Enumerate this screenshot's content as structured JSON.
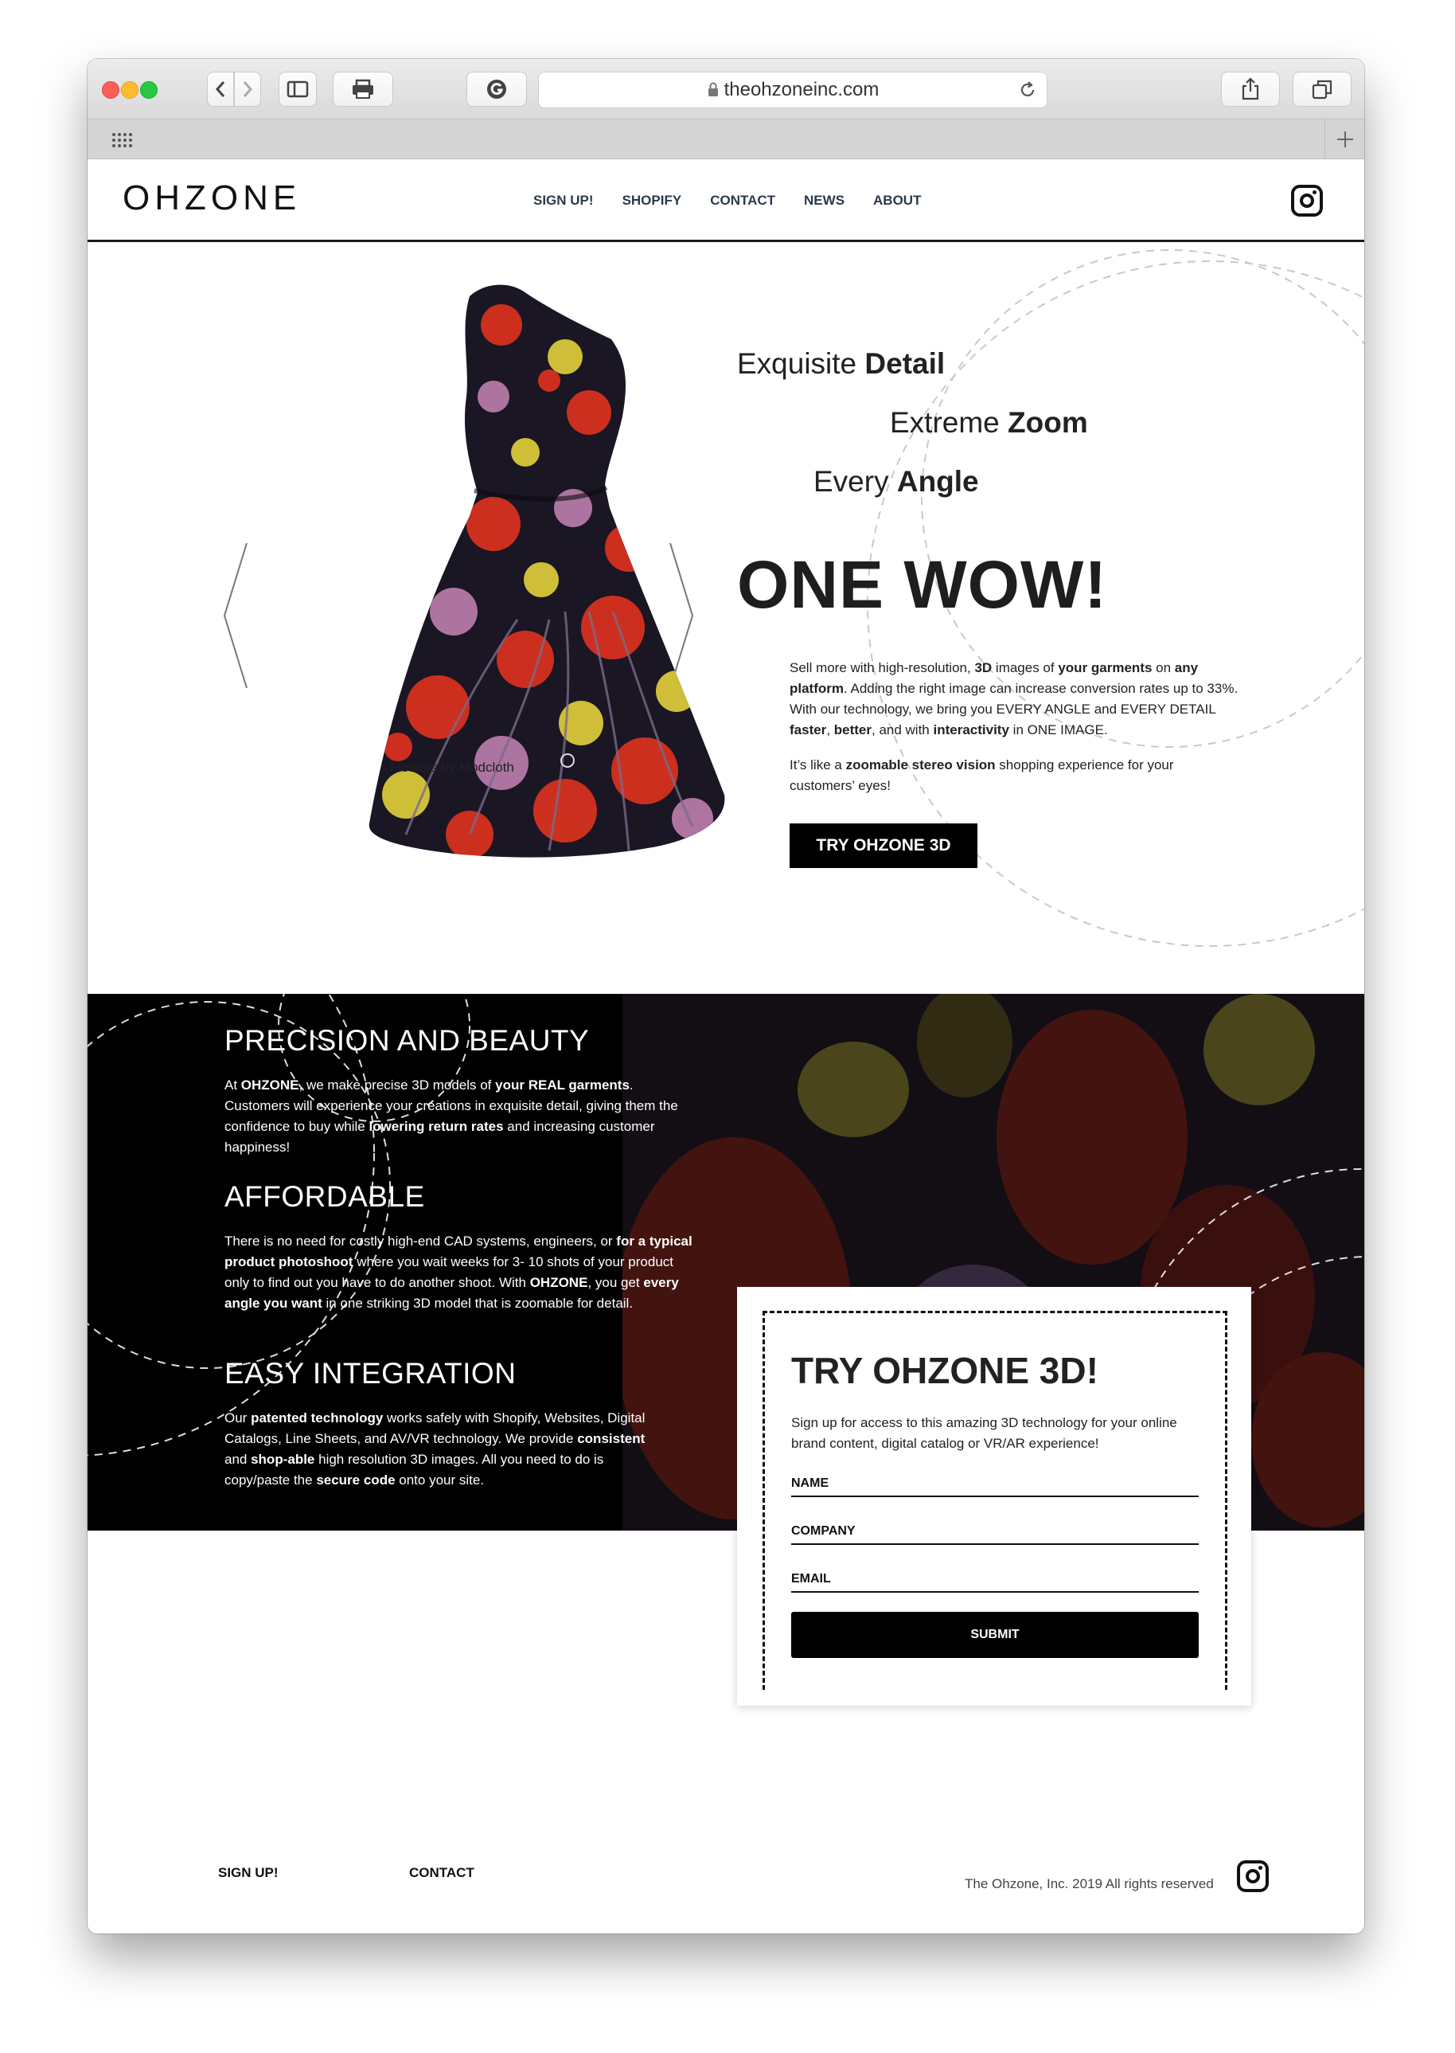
{
  "browser": {
    "url": "theohzoneinc.com"
  },
  "nav": {
    "logo": "OHZONE",
    "items": [
      "SIGN UP!",
      "SHOPIFY",
      "CONTACT",
      "NEWS",
      "ABOUT"
    ]
  },
  "hero": {
    "tagline1": {
      "light": "Exquisite ",
      "bold": "Detail"
    },
    "tagline2": {
      "light": "Extreme ",
      "bold": "Zoom"
    },
    "tagline3": {
      "light": "Every ",
      "bold": "Angle"
    },
    "headline": "ONE WOW!",
    "paragraph1": [
      {
        "t": "Sell more with high-resolution, "
      },
      {
        "t": "3D",
        "b": true
      },
      {
        "t": " images of "
      },
      {
        "t": "your garments",
        "b": true
      },
      {
        "t": " on "
      },
      {
        "t": "any platform",
        "b": true
      },
      {
        "t": ". Adding the right image can increase conversion rates up to 33%. With our technology, we bring you EVERY ANGLE and EVERY DETAIL "
      },
      {
        "t": "faster",
        "b": true
      },
      {
        "t": ", "
      },
      {
        "t": "better",
        "b": true
      },
      {
        "t": ", and with "
      },
      {
        "t": "interactivity",
        "b": true
      },
      {
        "t": " in ONE IMAGE."
      }
    ],
    "paragraph2": [
      {
        "t": "It’s like a "
      },
      {
        "t": "zoomable stereo vision",
        "b": true
      },
      {
        "t": " shopping experience for your customers’ eyes!"
      }
    ],
    "cta": "TRY OHZONE 3D",
    "caption": "Flowers by Modcloth"
  },
  "features": {
    "precision_title": "PRECISION AND BEAUTY",
    "precision_text": [
      {
        "t": "At "
      },
      {
        "t": "OHZONE",
        "b": true
      },
      {
        "t": ", we make precise 3D models of "
      },
      {
        "t": "your REAL garments",
        "b": true
      },
      {
        "t": ". Customers will experience your creations in exquisite detail, giving them the confidence to buy while "
      },
      {
        "t": "lowering return rates",
        "b": true
      },
      {
        "t": " and increasing customer happiness!"
      }
    ],
    "affordable_title": "AFFORDABLE",
    "affordable_text": [
      {
        "t": "There is no need for costly high-end CAD systems, engineers, or "
      },
      {
        "t": "for a typical product photoshoot",
        "b": true
      },
      {
        "t": " where you wait weeks for 3- 10 shots of your product only to find out you have to do another shoot. With "
      },
      {
        "t": "OHZONE",
        "b": true
      },
      {
        "t": ", you get "
      },
      {
        "t": "every angle you want",
        "b": true
      },
      {
        "t": " in one striking 3D model that is zoomable for detail."
      }
    ],
    "integration_title": "EASY INTEGRATION",
    "integration_text": [
      {
        "t": "Our "
      },
      {
        "t": "patented technology",
        "b": true
      },
      {
        "t": " works safely with Shopify, Websites, Digital Catalogs, Line Sheets, and AV/VR technology. We provide "
      },
      {
        "t": "consistent",
        "b": true
      },
      {
        "t": " and "
      },
      {
        "t": "shop-able",
        "b": true
      },
      {
        "t": " high resolution 3D images. All you need to do is copy/paste the "
      },
      {
        "t": "secure code",
        "b": true
      },
      {
        "t": " onto your site."
      }
    ]
  },
  "form": {
    "title": "TRY OHZONE 3D!",
    "description": "Sign up for access to this amazing 3D technology for your online brand content, digital catalog or VR/AR experience!",
    "name_label": "NAME",
    "company_label": "COMPANY",
    "email_label": "EMAIL",
    "submit": "SUBMIT"
  },
  "footer": {
    "signup": "SIGN UP!",
    "contact": "CONTACT",
    "copyright": "The Ohzone, Inc. 2019 All rights reserved"
  },
  "colors": {
    "dress_dark": "#1a1624",
    "flower_red": "#d6311f",
    "flower_yellow": "#d9c83a",
    "flower_pink": "#b67aa8"
  }
}
